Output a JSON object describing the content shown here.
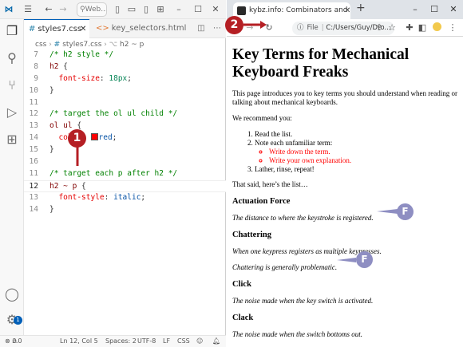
{
  "vscode": {
    "search_text": "Web...",
    "tabs": [
      {
        "label": "styles7.css",
        "active": true
      },
      {
        "label": "key_selectors.html",
        "active": false
      }
    ],
    "breadcrumb": [
      "css",
      "styles7.css",
      "h2 ~ p"
    ],
    "code_lines": [
      {
        "n": "7",
        "tokens": [
          {
            "t": "/* h2 style */",
            "c": "c-com"
          }
        ]
      },
      {
        "n": "8",
        "tokens": [
          {
            "t": "h2 ",
            "c": "c-sel"
          },
          {
            "t": "{",
            "c": "c-brace"
          }
        ]
      },
      {
        "n": "9",
        "tokens": [
          {
            "t": "  font-size",
            "c": "c-prop"
          },
          {
            "t": ": ",
            "c": "c-brace"
          },
          {
            "t": "18px",
            "c": "c-num"
          },
          {
            "t": ";",
            "c": "c-brace"
          }
        ]
      },
      {
        "n": "10",
        "tokens": [
          {
            "t": "}",
            "c": "c-brace"
          }
        ]
      },
      {
        "n": "11",
        "tokens": []
      },
      {
        "n": "12",
        "tokens": [
          {
            "t": "/* target the ol ul child */",
            "c": "c-com"
          }
        ]
      },
      {
        "n": "13",
        "tokens": [
          {
            "t": "ol ul ",
            "c": "c-sel"
          },
          {
            "t": "{",
            "c": "c-brace"
          }
        ]
      },
      {
        "n": "14",
        "tokens": [
          {
            "t": "  color",
            "c": "c-prop"
          },
          {
            "t": ": ",
            "c": "c-brace"
          },
          {
            "t": "SWATCH",
            "c": "swatch"
          },
          {
            "t": "red",
            "c": "c-val"
          },
          {
            "t": ";",
            "c": "c-brace"
          }
        ]
      },
      {
        "n": "15",
        "tokens": [
          {
            "t": "}",
            "c": "c-brace"
          }
        ]
      },
      {
        "n": "16",
        "tokens": []
      },
      {
        "n": "11",
        "tokens": [
          {
            "t": "/* target each p after h2 */",
            "c": "c-com"
          }
        ]
      },
      {
        "n": "12",
        "tokens": [
          {
            "t": "h2 ~ p ",
            "c": "c-sel"
          },
          {
            "t": "{",
            "c": "c-brace"
          }
        ],
        "current": true
      },
      {
        "n": "13",
        "tokens": [
          {
            "t": "  font-style",
            "c": "c-prop"
          },
          {
            "t": ": ",
            "c": "c-brace"
          },
          {
            "t": "italic",
            "c": "c-val"
          },
          {
            "t": ";",
            "c": "c-brace"
          }
        ]
      },
      {
        "n": "14",
        "tokens": [
          {
            "t": "}",
            "c": "c-brace"
          }
        ]
      }
    ],
    "status": {
      "errors": "0",
      "warnings": "0",
      "position": "Ln 12, Col 5",
      "spaces": "Spaces: 2",
      "encoding": "UTF-8",
      "eol": "LF",
      "language": "CSS"
    },
    "settings_badge": "1"
  },
  "browser": {
    "tab_title": "kybz.info: Combinators and Sele",
    "url_prefix": "File",
    "url": "C:/Users/Guy/Dro...",
    "page": {
      "title": "Key Terms for Mechanical Keyboard Freaks",
      "intro": "This page introduces you to key terms you should understand when reading or talking about mechanical keyboards.",
      "recommend": "We recommend you:",
      "list": [
        "Read the list.",
        "Note each unfamiliar term:",
        "Lather, rinse, repeat!"
      ],
      "sublist": [
        "Write down the term.",
        "Write your own explanation."
      ],
      "after_list": "That said, here’s the list…",
      "terms": [
        {
          "term": "Actuation Force",
          "paras": [
            "The distance to where the keystroke is registered."
          ]
        },
        {
          "term": "Chattering",
          "paras": [
            "When one keypress registers as multiple keypresses.",
            "Chattering is generally problematic."
          ]
        },
        {
          "term": "Click",
          "paras": [
            "The noise made when the key switch is activated."
          ]
        },
        {
          "term": "Clack",
          "paras": [
            "The noise made when the switch bottoms out."
          ]
        }
      ]
    }
  },
  "callouts": {
    "one": "1",
    "two": "2",
    "f": "F"
  },
  "colors": {
    "callout": "#b51f24",
    "f_callout": "#8e8ec2",
    "accent": "#005fb8",
    "red": "#ff0000"
  }
}
